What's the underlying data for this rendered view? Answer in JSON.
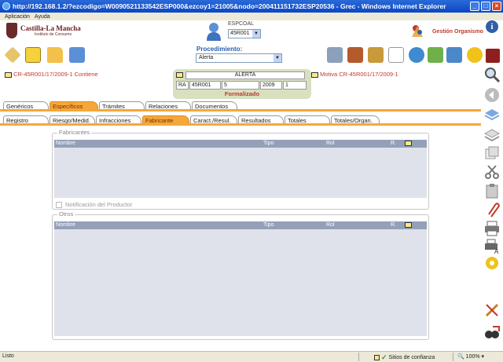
{
  "window": {
    "title": "http://192.168.1.2/?ezcodigo=W0090521133542ESP000&ezcoy1=21005&nodo=200411151732ESP20536 - Grec - Windows Internet Explorer"
  },
  "menu": {
    "items": [
      "Aplicación",
      "Ayuda"
    ]
  },
  "header": {
    "logo_name": "Castilla-La Mancha",
    "logo_sub": "Instituto de Consumo",
    "user_code": "ESPCOAL",
    "user_select": "45R001",
    "org_label": "Gestión Organismo"
  },
  "toolbar": {
    "proc_label": "Procedimiento:",
    "proc_value": "Alerta"
  },
  "info": {
    "contiene": "CR-45R001/17/2009-1 Contiene",
    "motiva": "Motiva CR-45R001/17/2009-1",
    "alert_title": "ALERTA",
    "alert_cells": [
      "RA",
      "45R001",
      "5",
      "2009",
      "1"
    ],
    "alert_status": "Formalizado"
  },
  "tabs_primary": [
    "Genéricos",
    "Específicos",
    "Trámites",
    "Relaciones",
    "Documentos"
  ],
  "tabs_secondary": [
    "Registro",
    "Riesgo/Medid.",
    "Infracciones",
    "Fabricante",
    "Caract./Resul.",
    "Resultados",
    "Totales",
    "Totales/Organ."
  ],
  "fabricantes": {
    "legend": "Fabricantes",
    "columns": [
      "Nombre",
      "Tipo",
      "Rol",
      "R."
    ],
    "checkbox_label": "Notificación del Productor"
  },
  "otros": {
    "legend": "Otros",
    "columns": [
      "Nombre",
      "Tipo",
      "Rol",
      "R."
    ]
  },
  "statusbar": {
    "status": "Listo",
    "zone": "Sitios de confianza",
    "zoom": "100%"
  },
  "colors": {
    "accent_orange": "#f5a73a",
    "link_red": "#c0392b",
    "grid_header": "#93a0b8",
    "titlebar_blue": "#0b47c4"
  }
}
